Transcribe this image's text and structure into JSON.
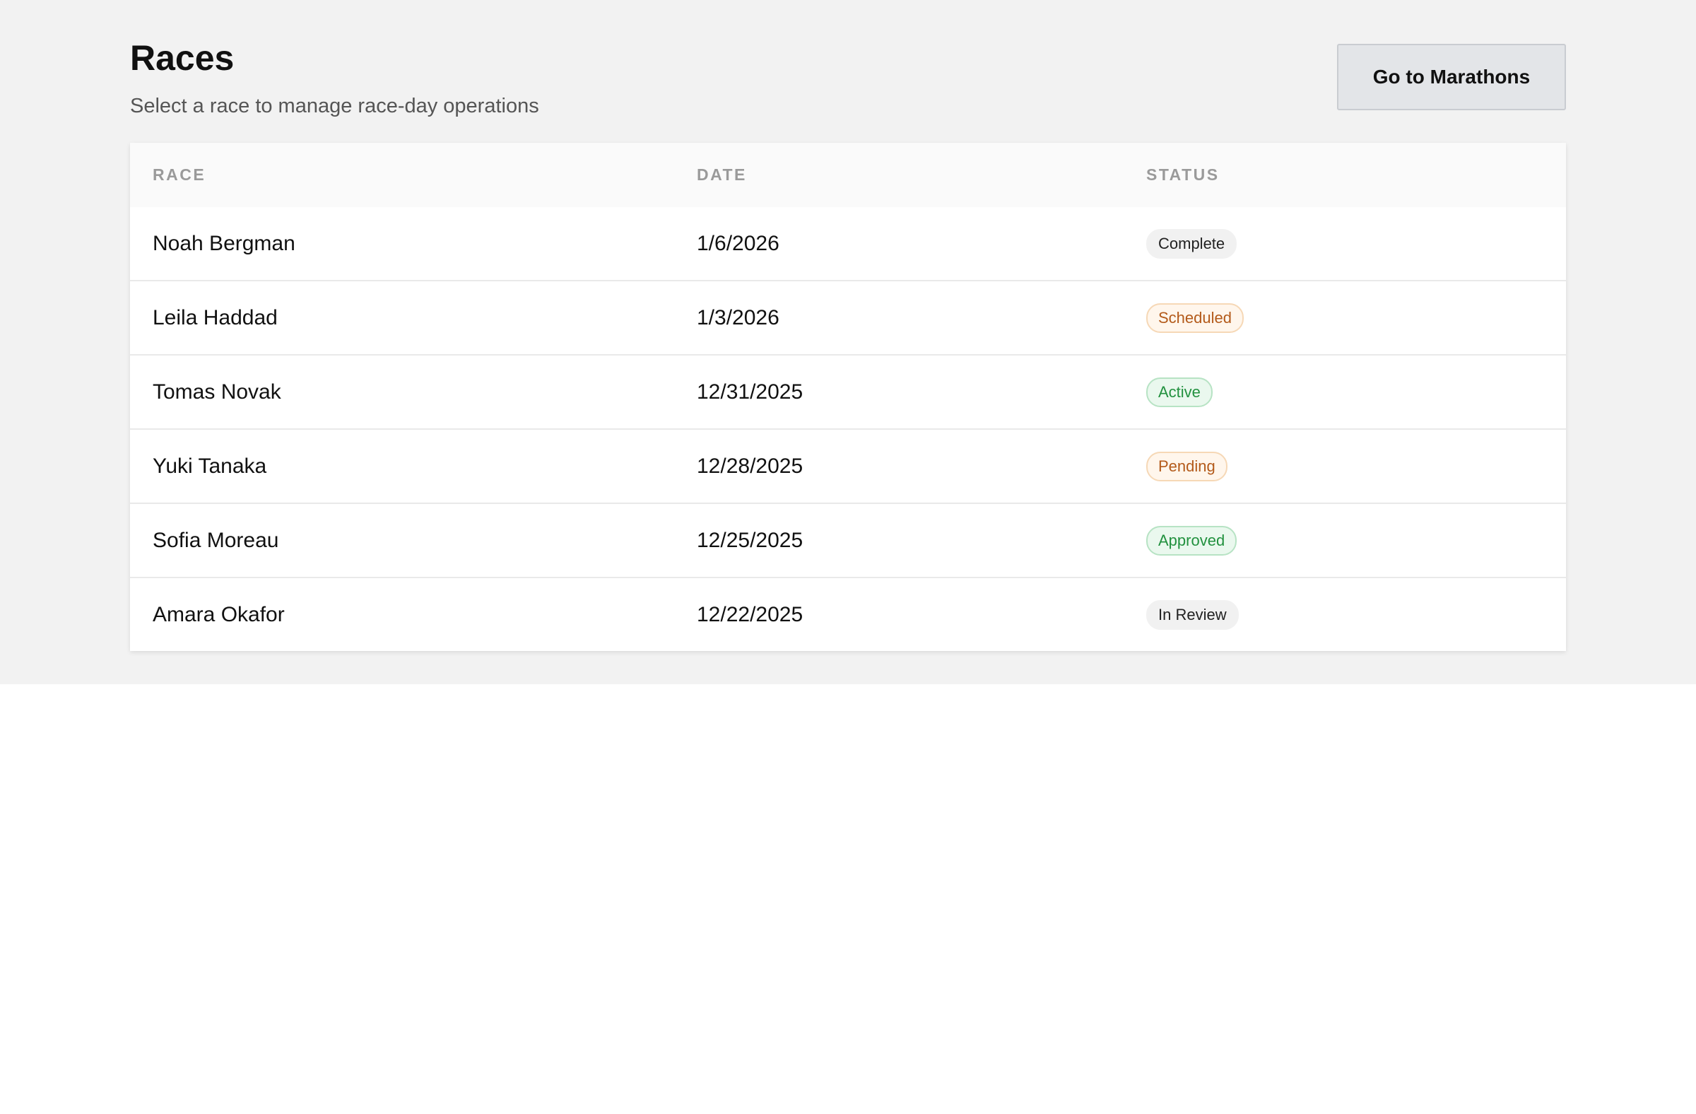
{
  "header": {
    "title": "Races",
    "subtitle": "Select a race to manage race-day operations",
    "nav_button_label": "Go to Marathons"
  },
  "table": {
    "columns": [
      "RACE",
      "DATE",
      "STATUS"
    ],
    "rows": [
      {
        "race": "Noah Bergman",
        "date": "1/6/2026",
        "status": "Complete",
        "status_tone": "neutral"
      },
      {
        "race": "Leila Haddad",
        "date": "1/3/2026",
        "status": "Scheduled",
        "status_tone": "warning"
      },
      {
        "race": "Tomas Novak",
        "date": "12/31/2025",
        "status": "Active",
        "status_tone": "success"
      },
      {
        "race": "Yuki Tanaka",
        "date": "12/28/2025",
        "status": "Pending",
        "status_tone": "warning"
      },
      {
        "race": "Sofia Moreau",
        "date": "12/25/2025",
        "status": "Approved",
        "status_tone": "success"
      },
      {
        "race": "Amara Okafor",
        "date": "12/22/2025",
        "status": "In Review",
        "status_tone": "neutral"
      }
    ]
  },
  "colors": {
    "page_background": "#f2f2f2",
    "neutral_badge": "#f1f1f1",
    "warning_badge_text": "#b35a1a",
    "success_badge_text": "#22913f"
  }
}
